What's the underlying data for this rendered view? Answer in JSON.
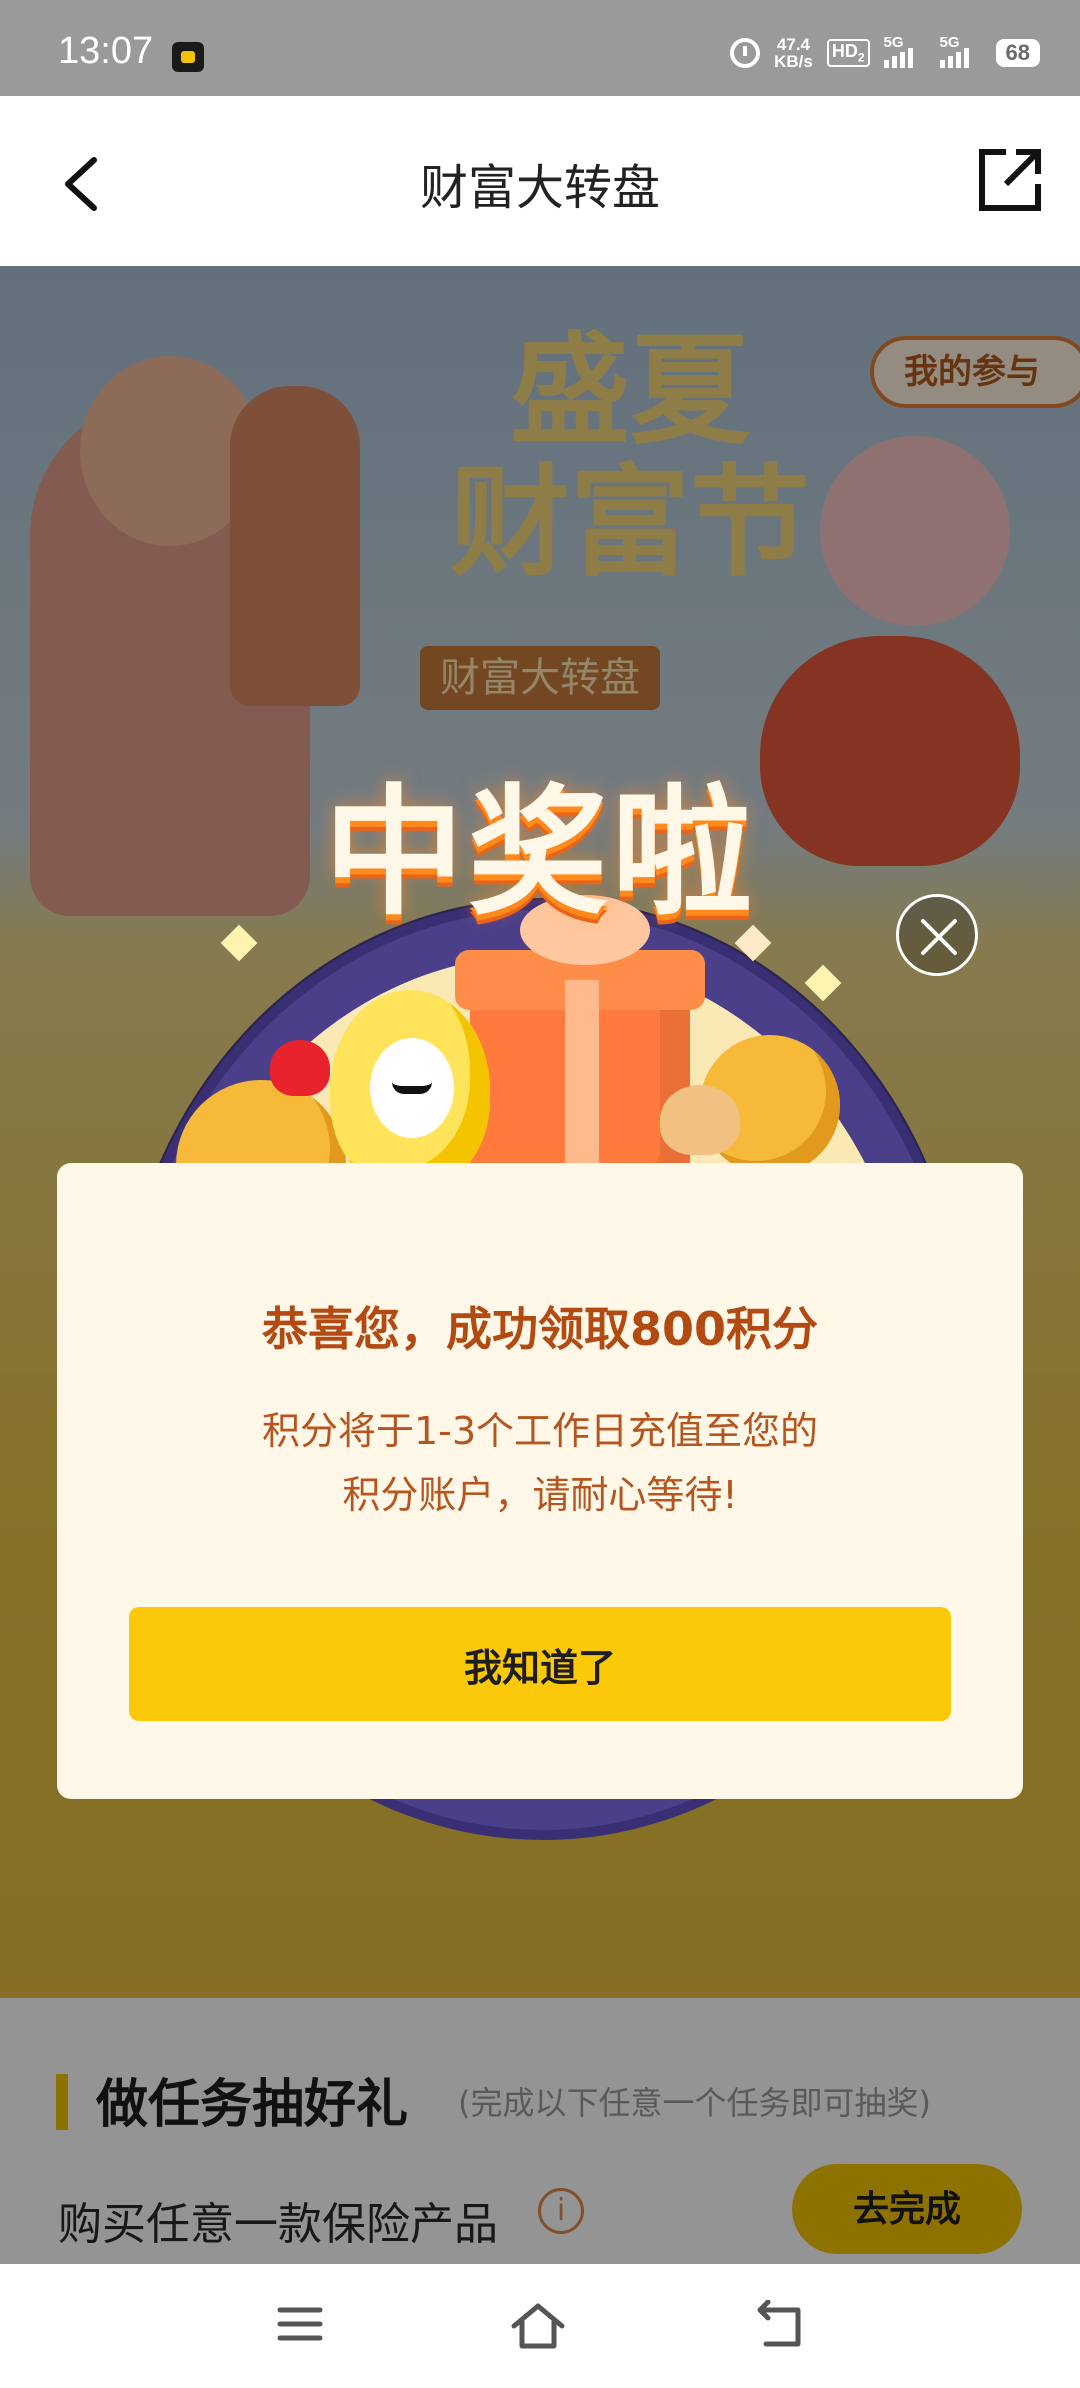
{
  "status_bar": {
    "time": "13:07",
    "net_speed_value": "47.4",
    "net_speed_unit": "KB/s",
    "hd_label": "HD",
    "hd_sub": "2",
    "signal1_label": "5G",
    "signal2_label": "5G",
    "battery": "68"
  },
  "nav": {
    "title": "财富大转盘",
    "back_icon": "chevron-left-icon",
    "share_icon": "share-external-icon"
  },
  "banner": {
    "title_line1": "盛夏",
    "title_line2": "财富节",
    "subtitle": "财富大转盘",
    "my_participation": "我的参与"
  },
  "popup": {
    "headline": "中奖啦",
    "title": "恭喜您，成功领取800积分",
    "message_line1": "积分将于1-3个工作日充值至您的",
    "message_line2": "积分账户，请耐心等待!",
    "confirm_label": "我知道了",
    "close_icon": "close-icon"
  },
  "tasks": {
    "title": "做任务抽好礼",
    "hint": "(完成以下任意一个任务即可抽奖)",
    "items": [
      {
        "label": "购买任意一款保险产品",
        "action": "去完成"
      }
    ]
  },
  "bottom_nav": {
    "icons": [
      "menu-icon",
      "home-icon",
      "back-icon"
    ]
  },
  "colors": {
    "accent_yellow": "#fbc80a",
    "popup_title": "#b24a12",
    "popup_bg": "#fff8e8"
  }
}
